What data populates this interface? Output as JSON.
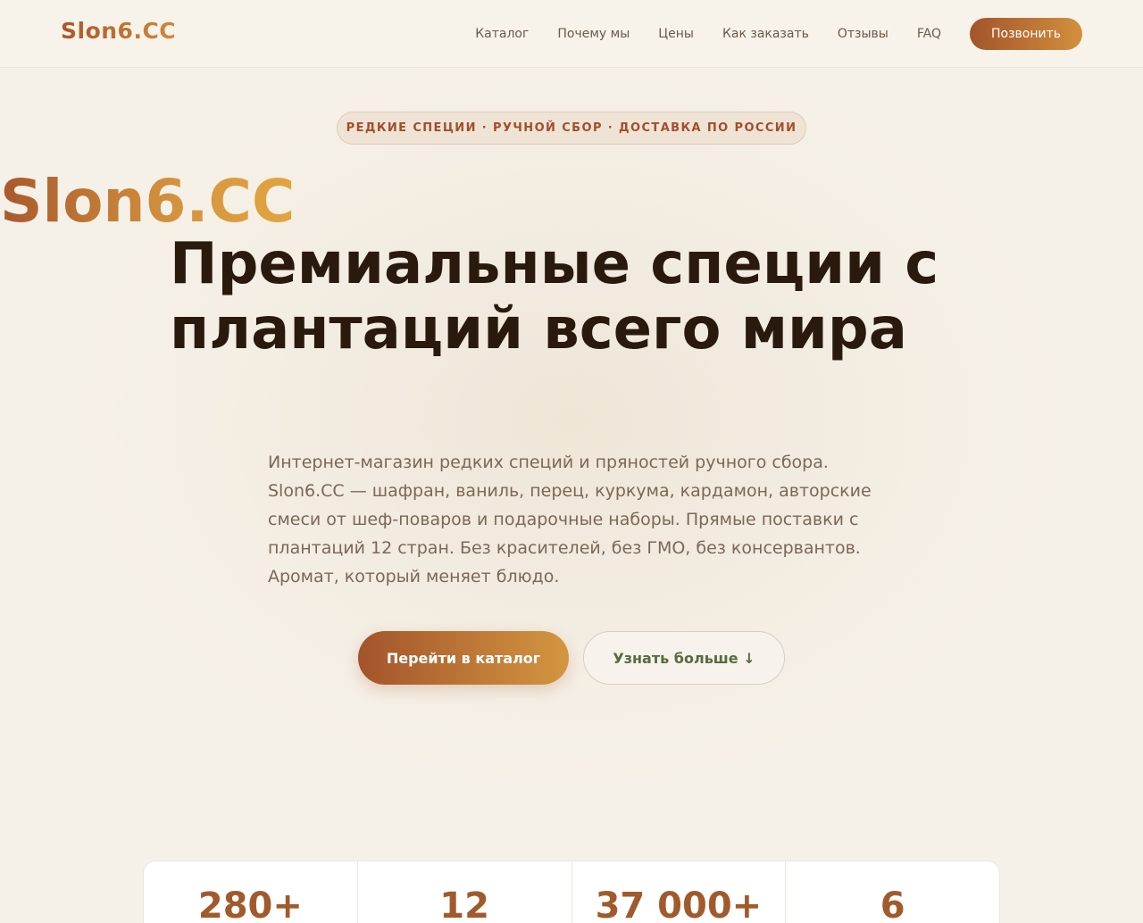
{
  "header": {
    "logo": "Slon6.CC",
    "nav": [
      "Каталог",
      "Почему мы",
      "Цены",
      "Как заказать",
      "Отзывы",
      "FAQ"
    ],
    "call_label": "Позвонить"
  },
  "hero": {
    "badge": "РЕДКИЕ СПЕЦИИ · РУЧНОЙ СБОР · ДОСТАВКА ПО РОССИИ",
    "brand": "Slon6.CC",
    "headline": "Премиальные специи с плантаций всего мира",
    "lead": "Интернет-магазин редких специй и пряностей ручного сбора. Slon6.CC — шафран, ваниль, перец, куркума, кардамон, авторские смеси от шеф-поваров и подарочные наборы. Прямые поставки с плантаций 12 стран. Без красителей, без ГМО, без консервантов. Аромат, который меняет блюдо.",
    "primary_cta": "Перейти в каталог",
    "secondary_cta": "Узнать больше ↓"
  },
  "stats": [
    "280+",
    "12",
    "37 000+",
    "6"
  ],
  "colors": {
    "accent_start": "#a3542b",
    "accent_end": "#d39640",
    "background": "#f6f1e8",
    "secondary_text": "#566b3e"
  }
}
